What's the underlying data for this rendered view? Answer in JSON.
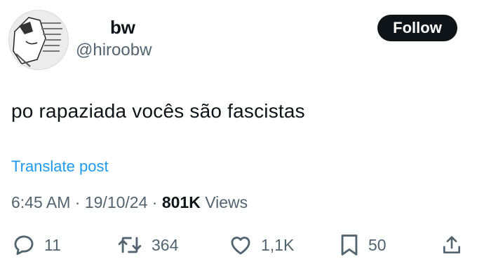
{
  "user": {
    "display_name": "bw",
    "handle": "@hiroobw"
  },
  "follow_button": {
    "label": "Follow"
  },
  "post": {
    "text": "po rapaziada vocês são fascistas",
    "translate_label": "Translate post",
    "time": "6:45 AM",
    "date": "19/10/24",
    "separator": "·",
    "views_count": "801K",
    "views_label": "Views"
  },
  "actions": {
    "replies": "11",
    "reposts": "364",
    "likes": "1,1K",
    "bookmarks": "50"
  },
  "colors": {
    "text": "#0f1419",
    "muted": "#536471",
    "link": "#1d9bf0",
    "button_bg": "#0f1419"
  }
}
